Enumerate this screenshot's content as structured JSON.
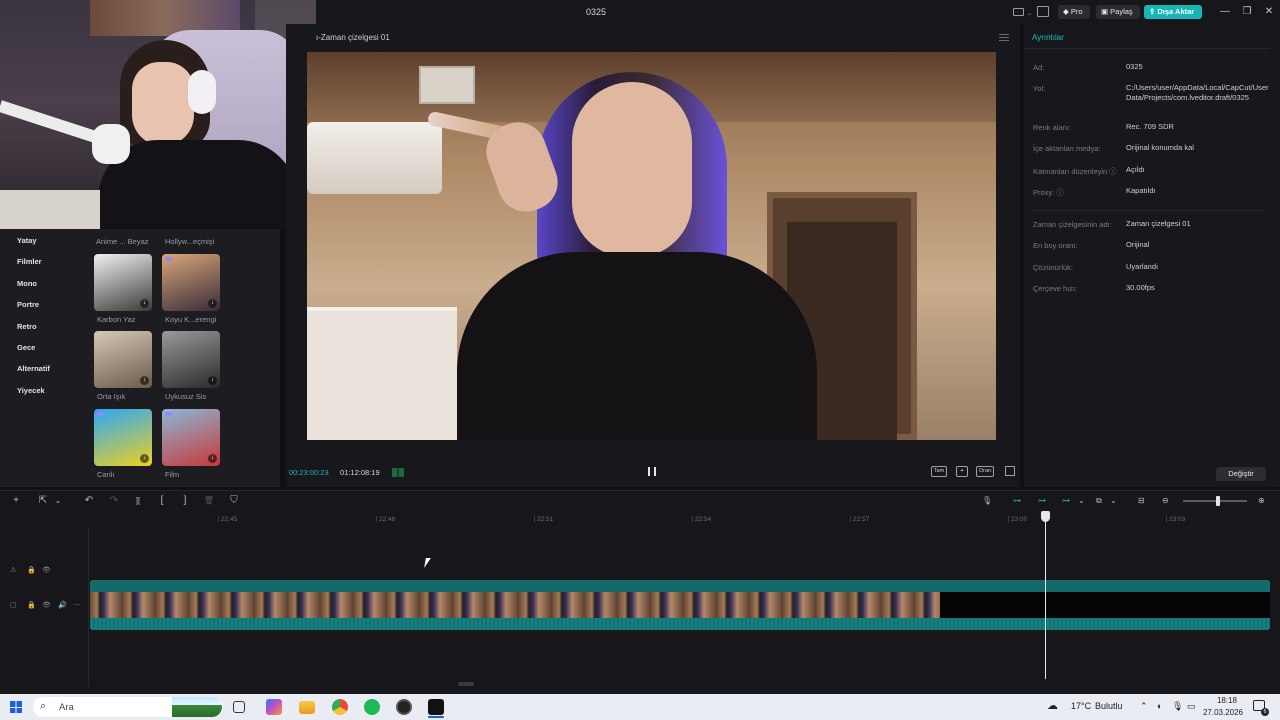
{
  "window": {
    "title": "0325",
    "pro_label": "Pro",
    "share_label": "Paylaş",
    "export_label": "Dışa Aktar",
    "minimize_glyph": "—",
    "restore_glyph": "❐",
    "close_glyph": "✕"
  },
  "filters": {
    "categories": [
      "Yatay",
      "Filmler",
      "Mono",
      "Portre",
      "Retro",
      "Gece",
      "Alternatif",
      "Yiyecek"
    ],
    "top_labels": [
      "Anime ... Beyaz",
      "Hollyw...eçmişi"
    ],
    "items": [
      {
        "label": "Karbon Yaz",
        "colors": [
          "#f2f2f2",
          "#3a3a3a"
        ]
      },
      {
        "label": "Koyu K...erengi",
        "colors": [
          "#d8a878",
          "#3a2a3a"
        ]
      },
      {
        "label": "Orta Işık",
        "colors": [
          "#d8c8b8",
          "#6a5a4a"
        ]
      },
      {
        "label": "Uykusuz Sis",
        "colors": [
          "#9a9a9a",
          "#2a2a2a"
        ]
      },
      {
        "label": "Canlı",
        "colors": [
          "#2aa8f8",
          "#f0d020"
        ]
      },
      {
        "label": "Film",
        "colors": [
          "#8ab8d8",
          "#c83838"
        ]
      }
    ],
    "download_glyph": "↓"
  },
  "player": {
    "title": "ı-Zaman çizelgesi 01",
    "time_current": "00:23:00:23",
    "time_total": "01:12:08:19",
    "ctl_full": "Tam",
    "ctl_ratio": "Oran"
  },
  "details": {
    "title": "Ayrıntılar",
    "rows": [
      {
        "label": "Ad:",
        "value": "0325"
      },
      {
        "label": "Yol:",
        "value": "C:/Users/user/AppData/Local/CapCut/User Data/Projects/com.lveditor.draft/0325"
      },
      {
        "label": "Renk alanı:",
        "value": "Rec. 709 SDR"
      },
      {
        "label": "İçe aktarılan medya:",
        "value": "Orijinal konumda kal"
      },
      {
        "label": "Katmanları düzenleyin ⓘ",
        "value": "Açıldı"
      },
      {
        "label": "Proxy: ⓘ",
        "value": "Kapatıldı"
      },
      {
        "label": "Zaman çizelgesinin adı:",
        "value": "Zaman çizelgesi 01"
      },
      {
        "label": "En boy oranı:",
        "value": "Orijinal"
      },
      {
        "label": "Çözünürlük:",
        "value": "Uyarlandı"
      },
      {
        "label": "Çerçeve hızı:",
        "value": "30.00fps"
      }
    ],
    "change_label": "Değiştir"
  },
  "timeline": {
    "ruler_ticks": [
      "22:45",
      "22:48",
      "22:51",
      "22:54",
      "22:57",
      "23:00",
      "23:03"
    ],
    "tools": {
      "add": "+",
      "select": "⇱",
      "select_chevron": "⌄",
      "undo": "↶",
      "redo": "↷",
      "split": "][",
      "split_left": "[",
      "split_right": "]",
      "delete": "🗑",
      "marker": "⛉"
    },
    "right_tools": {
      "mic": "🎙",
      "link1": "⊶",
      "link2": "⊶",
      "link3": "⊶",
      "link3_chevron": "⌄",
      "preview": "⧉",
      "preview_chevron": "⌄",
      "caption": "⊟",
      "zoom_out": "⊖",
      "zoom_in": "⊕"
    },
    "track_icons": {
      "overlay": "⚠",
      "lock": "🔒",
      "eye": "👁",
      "cover": "▢",
      "audio": "🔊",
      "more": "⋯"
    }
  },
  "taskbar": {
    "search_icon": "⌕",
    "search_placeholder": "Ara",
    "weather": "17°C",
    "weather_label": "Bulutlu",
    "tray_up": "⌃",
    "time": "18:18",
    "date": "27.03.2026",
    "notification_count": "6"
  }
}
